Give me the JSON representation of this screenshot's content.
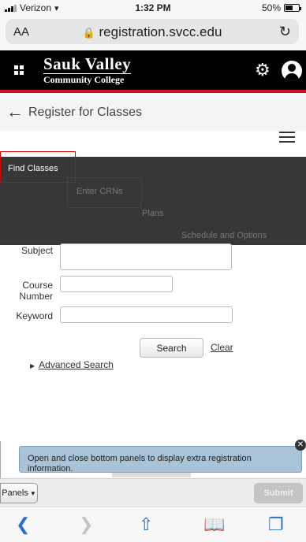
{
  "status_bar": {
    "carrier": "Verizon",
    "time": "1:32 PM",
    "battery": "50%"
  },
  "browser": {
    "text_size_label": "AA",
    "url": "registration.svcc.edu",
    "icons": {
      "lock": "lock-icon",
      "reload": "reload-icon"
    }
  },
  "header": {
    "logo_line1": "Sauk Valley",
    "logo_line2": "Community College",
    "colors": {
      "bar": "#000000",
      "accent": "#c8102e"
    }
  },
  "page": {
    "title": "Register for Classes"
  },
  "tabs": [
    {
      "label": "Find Classes",
      "active": true
    },
    {
      "label": "Enter CRNs",
      "active": false
    },
    {
      "label": "Plans",
      "active": false
    },
    {
      "label": "Schedule and Options",
      "active": false
    }
  ],
  "form": {
    "subject_label": "Subject",
    "course_number_label_1": "Course",
    "course_number_label_2": "Number",
    "keyword_label": "Keyword",
    "subject_value": "",
    "course_number_value": "",
    "keyword_value": "",
    "search_label": "Search",
    "clear_label": "Clear",
    "advanced_search_label": "Advanced Search"
  },
  "panel_tip": {
    "text": "Open and close bottom panels to display extra registration information."
  },
  "bottom_bar": {
    "panels_label": "Panels",
    "submit_label": "Submit"
  }
}
